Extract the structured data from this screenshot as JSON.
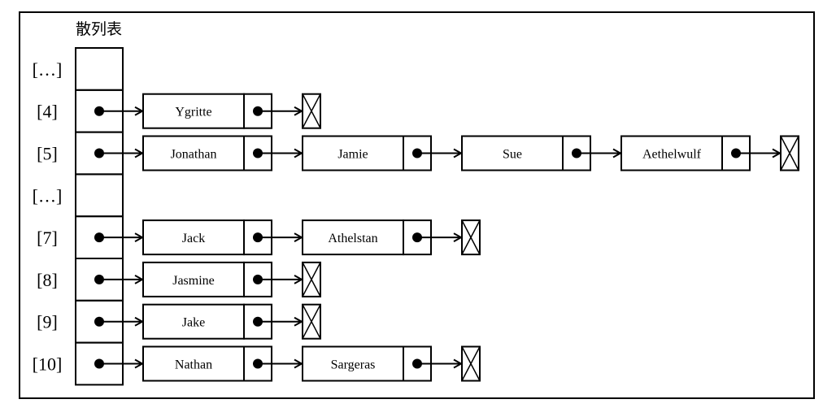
{
  "title": "散列表",
  "colors": {
    "stroke": "#000000",
    "background": "#ffffff"
  },
  "buckets": [
    {
      "label": "[…]",
      "nodes": null
    },
    {
      "label": "[4]",
      "nodes": [
        "Ygritte"
      ]
    },
    {
      "label": "[5]",
      "nodes": [
        "Jonathan",
        "Jamie",
        "Sue",
        "Aethelwulf"
      ]
    },
    {
      "label": "[…]",
      "nodes": null
    },
    {
      "label": "[7]",
      "nodes": [
        "Jack",
        "Athelstan"
      ]
    },
    {
      "label": "[8]",
      "nodes": [
        "Jasmine"
      ]
    },
    {
      "label": "[9]",
      "nodes": [
        "Jake"
      ]
    },
    {
      "label": "[10]",
      "nodes": [
        "Nathan",
        "Sargeras"
      ]
    }
  ]
}
